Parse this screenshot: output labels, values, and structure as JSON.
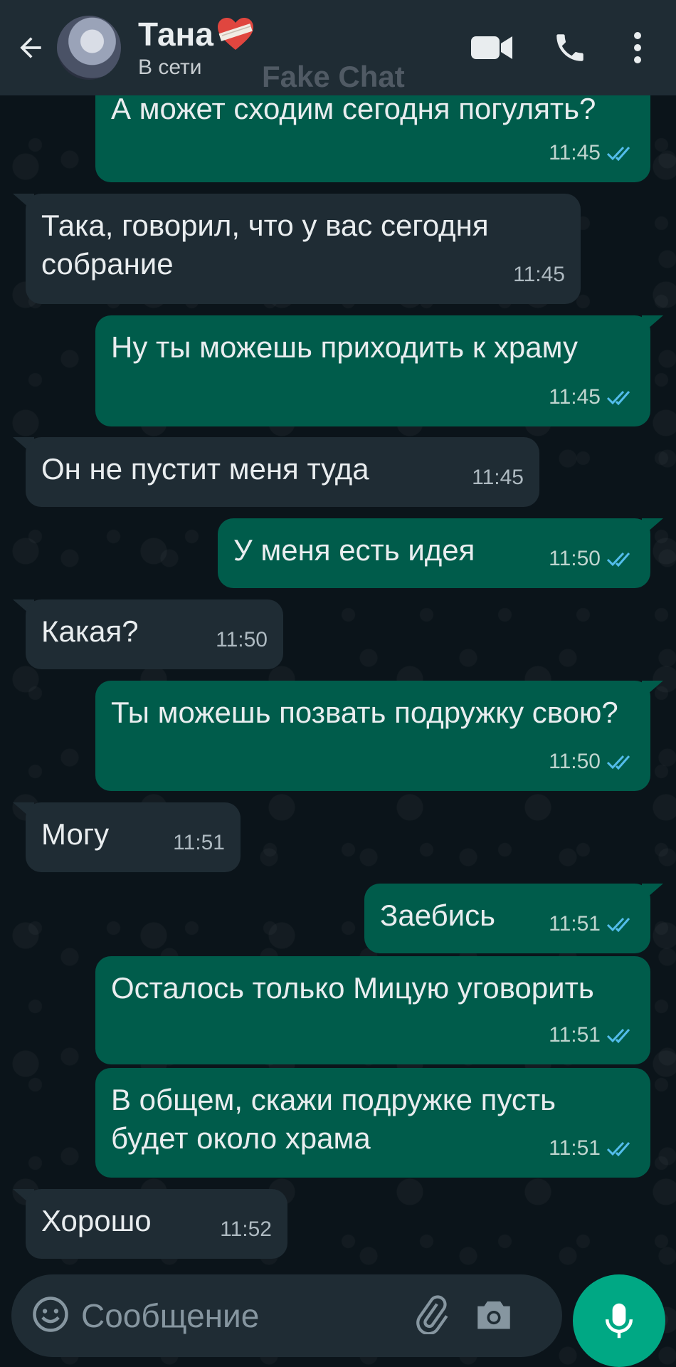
{
  "header": {
    "contact_name": "Тана",
    "status": "В сети",
    "watermark": "Fake Chat"
  },
  "messages": [
    {
      "dir": "out",
      "text": "А может сходим сегодня погулять?",
      "time": "11:45"
    },
    {
      "dir": "in",
      "text": "Така, говорил, что у вас сегодня собрание",
      "time": "11:45"
    },
    {
      "dir": "out",
      "text": "Ну ты можешь приходить к храму",
      "time": "11:45"
    },
    {
      "dir": "in",
      "text": "Он не пустит меня туда",
      "time": "11:45"
    },
    {
      "dir": "out",
      "text": "У меня есть идея",
      "time": "11:50"
    },
    {
      "dir": "in",
      "text": "Какая?",
      "time": "11:50"
    },
    {
      "dir": "out",
      "text": "Ты можешь позвать подружку свою?",
      "time": "11:50"
    },
    {
      "dir": "in",
      "text": "Могу",
      "time": "11:51"
    },
    {
      "dir": "out",
      "text": "Заебись",
      "time": "11:51"
    },
    {
      "dir": "out",
      "text": "Осталось только Мицую уговорить",
      "time": "11:51"
    },
    {
      "dir": "out",
      "text": "В общем, скажи подружке пусть будет около храма",
      "time": "11:51"
    },
    {
      "dir": "in",
      "text": "Хорошо",
      "time": "11:52"
    }
  ],
  "composer": {
    "placeholder": "Сообщение"
  },
  "colors": {
    "background": "#0b141a",
    "header": "#1f2c34",
    "incoming_bubble": "#1f2c34",
    "outgoing_bubble": "#005c4b",
    "read_ticks": "#53bdeb",
    "mic_button": "#00a884"
  },
  "icons": {
    "back": "arrow-left-icon",
    "video_call": "video-camera-icon",
    "voice_call": "phone-icon",
    "menu": "more-vertical-icon",
    "emoji": "emoji-icon",
    "attach": "paperclip-icon",
    "camera": "camera-icon",
    "mic": "microphone-icon",
    "read_receipt": "double-check-icon"
  }
}
